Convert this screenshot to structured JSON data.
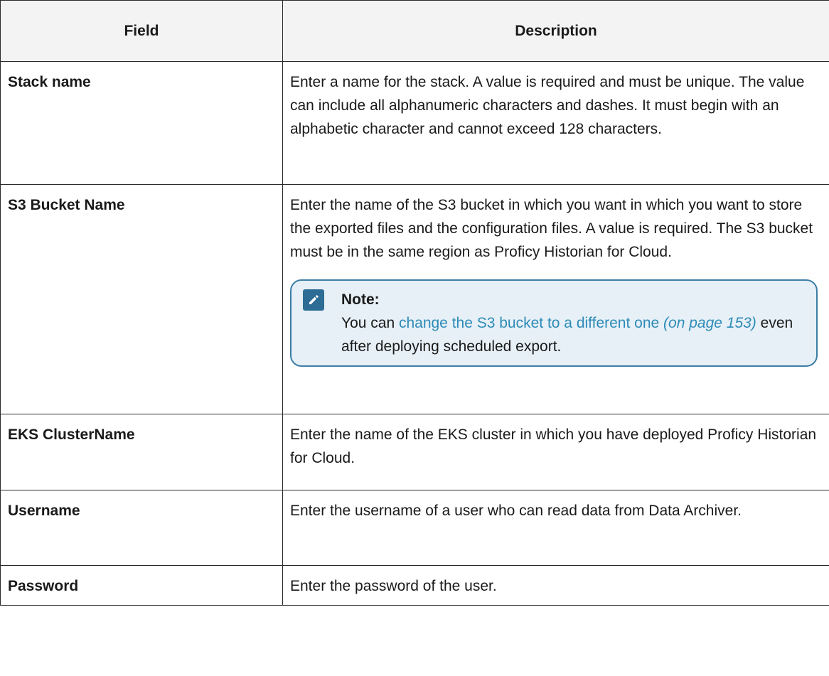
{
  "table": {
    "headers": {
      "field": "Field",
      "description": "Description"
    },
    "rows": [
      {
        "field": "Stack name",
        "description": "Enter a name for the stack. A value is required and must be unique. The value can include all alphanumeric characters and dashes. It must begin with an alphabetic character and cannot exceed 128 characters."
      },
      {
        "field": "S3 Bucket Name",
        "description": "Enter the name of the S3 bucket in which you want in which you want to store the exported files and the configuration files. A value is required. The S3 bucket must be in the same region as Proficy Historian for Cloud.",
        "note": {
          "title": "Note:",
          "text_before": "You can ",
          "link_text": "change the S3 bucket to a different one",
          "page_ref": "(on page 153)",
          "text_after": " even after deploying scheduled export.",
          "icon": "pencil-note-icon"
        }
      },
      {
        "field": "EKS ClusterName",
        "description": "Enter the name of the EKS cluster in which you have deployed Proficy Historian for Cloud."
      },
      {
        "field": "Username",
        "description": "Enter the username of a user who can read data from Data Archiver."
      },
      {
        "field": "Password",
        "description": "Enter the password of the user."
      }
    ]
  },
  "colors": {
    "note_border": "#3d7ea6",
    "note_background": "#e6f0f6",
    "link": "#2e8bb8",
    "icon_background": "#2d6c95"
  }
}
